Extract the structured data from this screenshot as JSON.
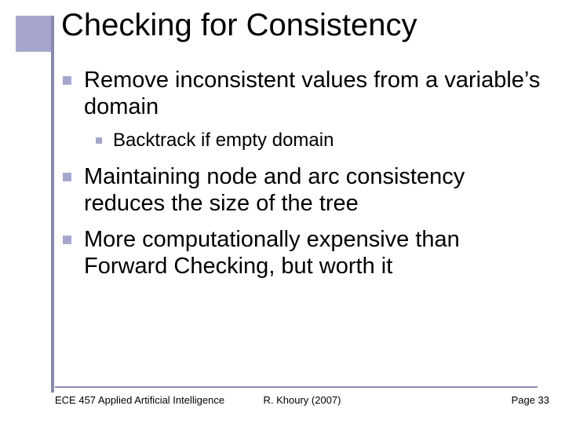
{
  "title": "Checking for Consistency",
  "bullets": [
    {
      "level": 1,
      "text": "Remove inconsistent values from a variable’s domain"
    },
    {
      "level": 2,
      "text": "Backtrack if empty domain"
    },
    {
      "level": 1,
      "text": "Maintaining node and arc consistency reduces the size of the tree"
    },
    {
      "level": 1,
      "text": "More computationally expensive than Forward Checking, but worth it"
    }
  ],
  "footer": {
    "left": "ECE 457 Applied Artificial Intelligence",
    "center": "R. Khoury (2007)",
    "right": "Page 33"
  },
  "accent_color": "#a6a6cc"
}
